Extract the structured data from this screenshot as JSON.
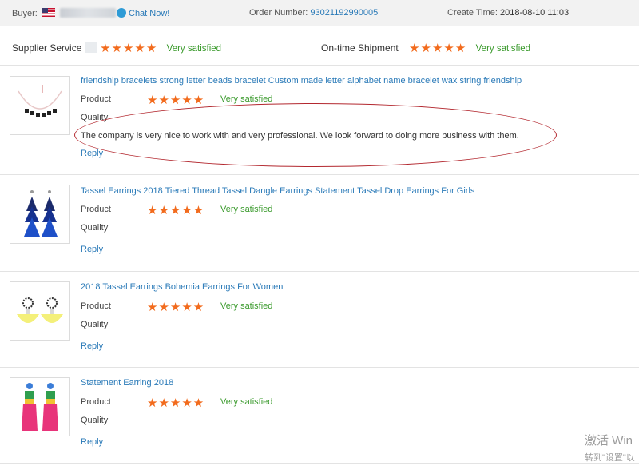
{
  "header": {
    "buyer_label": "Buyer:",
    "chat_label": "Chat Now!",
    "order_label": "Order Number:",
    "order_number": "93021192990005",
    "create_label": "Create Time:",
    "create_time": "2018-08-10 11:03"
  },
  "ratings": {
    "supplier_label": "Supplier Service",
    "supplier_stars": "★★★★★",
    "supplier_value": "Very satisfied",
    "shipment_label": "On-time Shipment",
    "shipment_stars": "★★★★★",
    "shipment_value": "Very satisfied"
  },
  "items": [
    {
      "title": "friendship bracelets strong letter beads bracelet Custom made letter alphabet name bracelet wax string friendship",
      "product_label": "Product",
      "stars": "★★★★★",
      "rating": "Very satisfied",
      "quality_label": "Quality",
      "review": "The company is very nice to work with and very professional. We look forward to doing more business with them.",
      "reply": "Reply"
    },
    {
      "title": "Tassel Earrings 2018 Tiered Thread Tassel Dangle Earrings Statement Tassel Drop Earrings For Girls",
      "product_label": "Product",
      "stars": "★★★★★",
      "rating": "Very satisfied",
      "quality_label": "Quality",
      "reply": "Reply"
    },
    {
      "title": "2018 Tassel Earrings Bohemia Earrings For Women",
      "product_label": "Product",
      "stars": "★★★★★",
      "rating": "Very satisfied",
      "quality_label": "Quality",
      "reply": "Reply"
    },
    {
      "title": "Statement Earring 2018",
      "product_label": "Product",
      "stars": "★★★★★",
      "rating": "Very satisfied",
      "quality_label": "Quality",
      "reply": "Reply"
    }
  ],
  "watermark": {
    "line1": "激活 Win",
    "line2": "转到\"设置\"以"
  },
  "colors": {
    "link": "#2a7ab8",
    "star": "#f26b1d",
    "satisfied": "#3a9a2c",
    "annotation": "#b3282f"
  }
}
